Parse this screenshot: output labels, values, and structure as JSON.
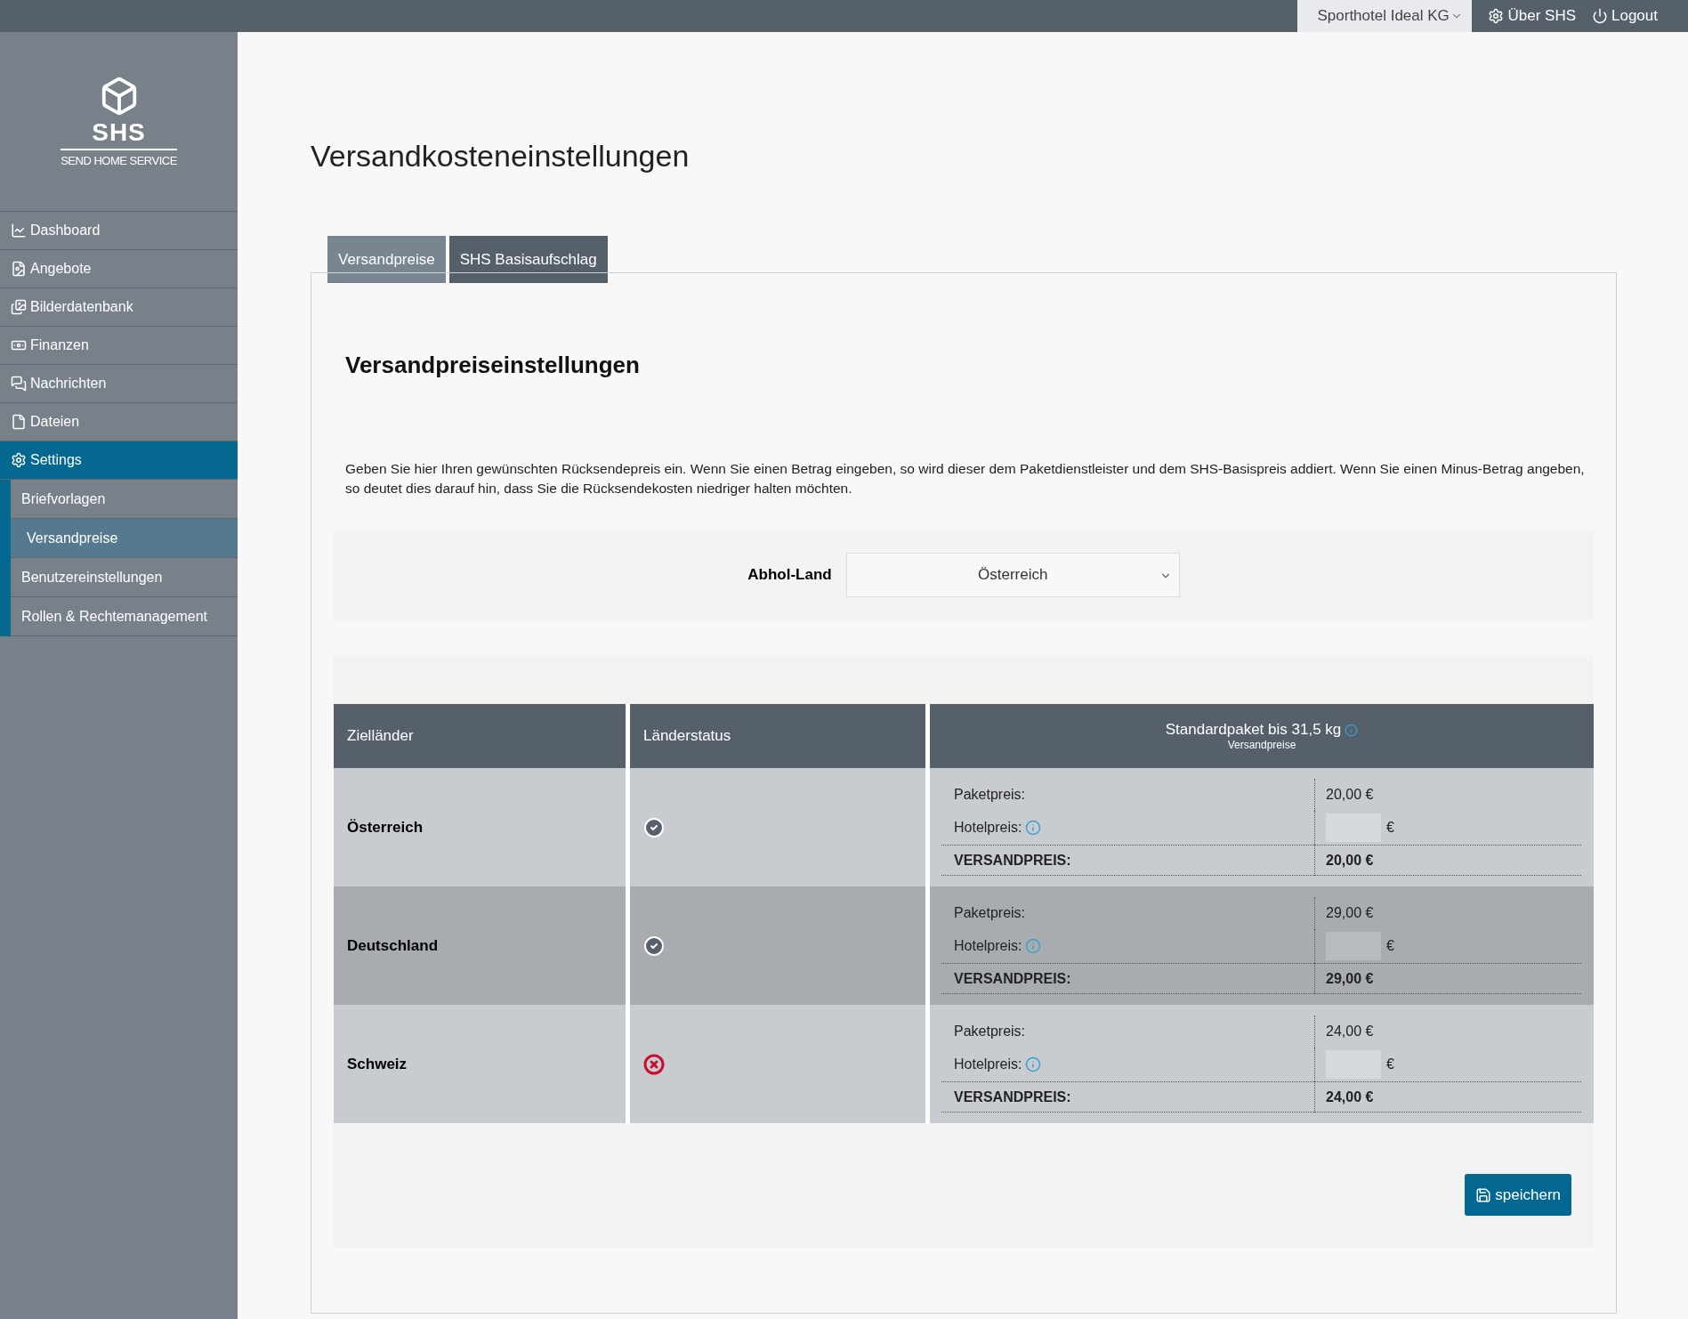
{
  "topbar": {
    "company_select": {
      "value": "Sporthotel Ideal KG"
    },
    "links": [
      {
        "kind": "settings",
        "label": "Über SHS"
      },
      {
        "kind": "power",
        "label": "Logout"
      }
    ]
  },
  "sidebar": {
    "logo": {
      "title": "SHS",
      "subtitle": "SEND HOME SERVICE"
    },
    "items": [
      {
        "kind": "chart",
        "label": "Dashboard",
        "selected": false
      },
      {
        "kind": "document",
        "label": "Angebote",
        "selected": false
      },
      {
        "kind": "images",
        "label": "Bilderdatenbank",
        "selected": false
      },
      {
        "kind": "money",
        "label": "Finanzen",
        "selected": false
      },
      {
        "kind": "chat",
        "label": "Nachrichten",
        "selected": false
      },
      {
        "kind": "file",
        "label": "Dateien",
        "selected": false
      },
      {
        "kind": "settings",
        "label": "Settings",
        "selected": true,
        "children": [
          {
            "label": "Briefvorlagen",
            "selected": false
          },
          {
            "label": "Versandpreise",
            "selected": true
          },
          {
            "label": "Benutzereinstellungen",
            "selected": false
          },
          {
            "label": "Rollen & Rechtemanagement",
            "selected": false
          }
        ]
      }
    ]
  },
  "page_title": "Versandkosteneinstellungen",
  "tabs": [
    {
      "label": "Versandpreise",
      "selected": true
    },
    {
      "label": "SHS Basisaufschlag",
      "selected": false
    }
  ],
  "section_title": "Versandpreiseinstellungen",
  "description": "Geben Sie hier Ihren gewünschten Rücksendepreis ein. Wenn Sie einen Betrag eingeben, so wird dieser dem Paketdienstleister und dem SHS-Basispreis addiert. Wenn Sie einen Minus-Betrag angeben, so deutet dies darauf hin, dass Sie die Rücksendekosten niedriger halten möchten.",
  "pickup": {
    "label": "Abhol-Land",
    "value": "Österreich"
  },
  "table": {
    "columns": [
      "Zielländer",
      "Länderstatus"
    ],
    "price_header": {
      "title": "Standardpaket bis 31,5 kg",
      "subtitle": "Versandpreise"
    },
    "rows": [
      {
        "country": "Österreich",
        "active": true,
        "paket_label": "Paketpreis:",
        "paket_value": "20,00 €",
        "hotel_label": "Hotelpreis:",
        "currency": "€",
        "total_label": "VERSANDPREIS:",
        "total_value": "20,00 €"
      },
      {
        "country": "Deutschland",
        "active": true,
        "paket_label": "Paketpreis:",
        "paket_value": "29,00 €",
        "hotel_label": "Hotelpreis:",
        "currency": "€",
        "total_label": "VERSANDPREIS:",
        "total_value": "29,00 €"
      },
      {
        "country": "Schweiz",
        "active": false,
        "paket_label": "Paketpreis:",
        "paket_value": "24,00 €",
        "hotel_label": "Hotelpreis:",
        "currency": "€",
        "total_label": "VERSANDPREIS:",
        "total_value": "24,00 €"
      }
    ]
  },
  "save_button": {
    "label": "speichern"
  }
}
